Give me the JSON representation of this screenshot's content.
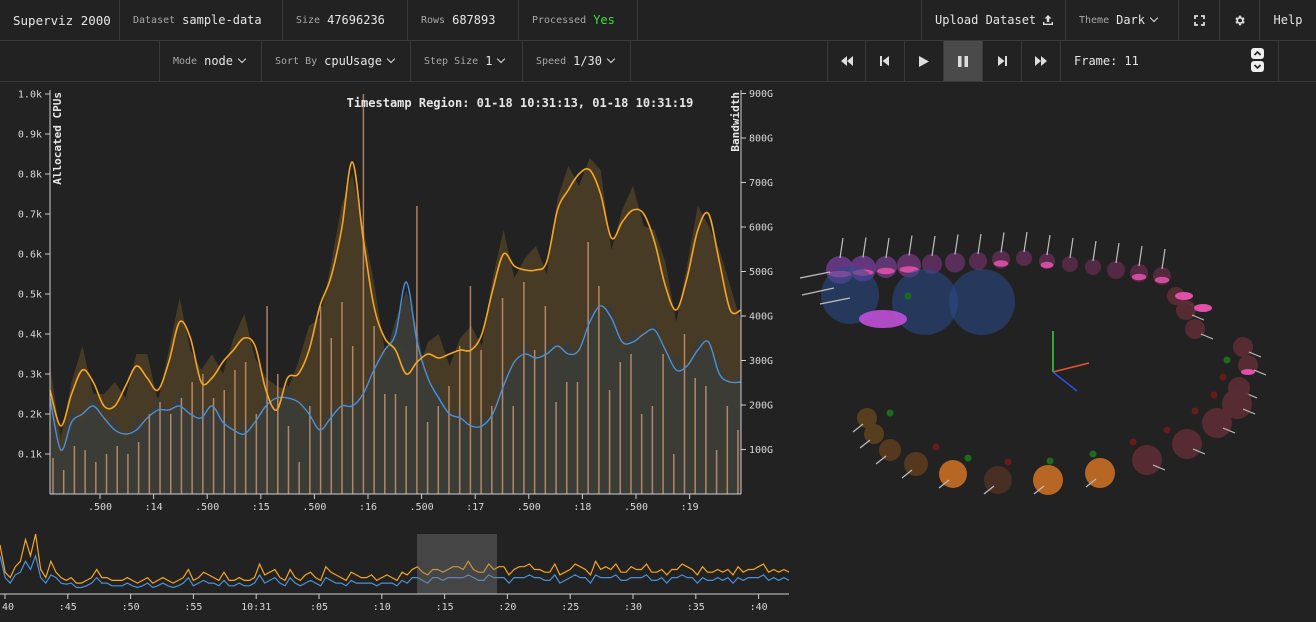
{
  "app": {
    "title": "Superviz 2000",
    "dataset_label": "Dataset",
    "dataset_value": "sample-data",
    "size_label": "Size",
    "size_value": "47696236",
    "rows_label": "Rows",
    "rows_value": "687893",
    "processed_label": "Processed",
    "processed_value": "Yes",
    "upload_label": "Upload Dataset",
    "theme_label": "Theme",
    "theme_value": "Dark",
    "help_label": "Help"
  },
  "controls": {
    "mode_label": "Mode",
    "mode_value": "node",
    "sort_label": "Sort By",
    "sort_value": "cpuUsage",
    "step_label": "Step Size",
    "step_value": "1",
    "speed_label": "Speed",
    "speed_value": "1/30",
    "frame_label": "Frame:",
    "frame_value": "11"
  },
  "icons": [
    "upload-icon",
    "fullscreen-icon",
    "gear-icon",
    "rewind-icon",
    "step-back-icon",
    "play-icon",
    "pause-icon",
    "step-forward-icon",
    "fast-forward-icon",
    "spin-up-icon",
    "spin-down-icon"
  ],
  "colors": {
    "background": "#222222",
    "cpu_line": "#f5a623",
    "bandwidth_line": "#4a90d9",
    "cpu_area": "#4a3d27",
    "bandwidth_area": "#3c3c38",
    "bars": "#d8a07a",
    "processed": "#3ddc3d"
  },
  "chart_data": [
    {
      "type": "line",
      "title": "Timestamp Region: 01-18 10:31:13, 01-18 10:31:19",
      "ylabel": "Allocated CPUs",
      "y2label": "Bandwidth",
      "ylim": [
        0,
        1000
      ],
      "y2lim": [
        0,
        1000
      ],
      "x_ticks": [
        ".500",
        ":14",
        ".500",
        ":15",
        ".500",
        ":16",
        ".500",
        ":17",
        ".500",
        ":18",
        ".500",
        ":19"
      ],
      "y_ticks": [
        "0.1k",
        "0.2k",
        "0.3k",
        "0.4k",
        "0.5k",
        "0.6k",
        "0.7k",
        "0.8k",
        "0.9k",
        "1.0k"
      ],
      "y2_ticks": [
        "100G",
        "200G",
        "300G",
        "400G",
        "500G",
        "600G",
        "700G",
        "800G",
        "900G"
      ],
      "series": [
        {
          "values": [
            260,
            170,
            250,
            310,
            280,
            220,
            220,
            270,
            320,
            290,
            260,
            330,
            430,
            390,
            280,
            290,
            330,
            360,
            390,
            370,
            260,
            210,
            290,
            300,
            360,
            470,
            540,
            660,
            830,
            640,
            470,
            390,
            360,
            300,
            330,
            350,
            340,
            350,
            360,
            360,
            400,
            510,
            600,
            570,
            560,
            560,
            580,
            710,
            760,
            800,
            810,
            750,
            640,
            680,
            710,
            700,
            630,
            520,
            460,
            540,
            660,
            700,
            580,
            460,
            460
          ]
        },
        {
          "values": [
            240,
            110,
            180,
            200,
            220,
            190,
            160,
            150,
            160,
            190,
            210,
            210,
            220,
            200,
            190,
            220,
            180,
            160,
            150,
            180,
            220,
            240,
            240,
            230,
            200,
            160,
            190,
            220,
            220,
            250,
            310,
            360,
            400,
            530,
            380,
            290,
            240,
            200,
            190,
            170,
            170,
            200,
            270,
            330,
            350,
            340,
            350,
            370,
            350,
            360,
            430,
            470,
            440,
            380,
            380,
            400,
            410,
            360,
            310,
            320,
            360,
            380,
            300,
            280,
            280
          ]
        }
      ],
      "bars": [
        90,
        60,
        120,
        110,
        80,
        100,
        120,
        100,
        130,
        200,
        230,
        200,
        240,
        280,
        300,
        240,
        260,
        310,
        330,
        200,
        470,
        300,
        170,
        80,
        220,
        470,
        390,
        480,
        370,
        1000,
        420,
        250,
        250,
        220,
        720,
        180,
        220,
        270,
        370,
        520,
        360,
        220,
        490,
        220,
        530,
        360,
        470,
        230,
        280,
        280,
        630,
        520,
        260,
        330,
        350,
        200,
        220,
        350,
        100,
        400,
        290,
        270,
        110,
        220,
        160
      ]
    },
    {
      "type": "line",
      "x_ticks": [
        ":40",
        ":45",
        ":50",
        ":55",
        "10:31",
        ":05",
        ":10",
        ":15",
        ":20",
        ":25",
        ":30",
        ":35",
        ":40"
      ],
      "brush_range": [
        ":13",
        ":19"
      ],
      "series": [
        {
          "values": [
            90,
            40,
            30,
            50,
            60,
            100,
            70,
            110,
            45,
            30,
            60,
            40,
            30,
            25,
            30,
            20,
            20,
            25,
            30,
            45,
            30,
            30,
            25,
            25,
            25,
            30,
            25,
            20,
            25,
            30,
            20,
            25,
            30,
            25,
            20,
            25,
            30,
            45,
            25,
            30,
            40,
            35,
            30,
            25,
            40,
            25,
            25,
            30,
            25,
            25,
            30,
            55,
            35,
            40,
            45,
            30,
            25,
            45,
            30,
            25,
            35,
            40,
            30,
            25,
            50,
            40,
            35,
            30,
            25,
            40,
            35,
            30,
            30,
            35,
            25,
            30,
            35,
            30,
            25,
            40,
            35,
            45,
            50,
            40,
            35,
            45,
            45,
            40,
            45,
            50,
            50,
            45,
            60,
            45,
            40,
            40,
            55,
            45,
            50,
            50,
            35,
            45,
            50,
            50,
            55,
            45,
            45,
            40,
            40,
            55,
            35,
            40,
            45,
            55,
            50,
            45,
            35,
            60,
            45,
            50,
            45,
            55,
            40,
            40,
            50,
            45,
            45,
            55,
            40,
            40,
            45,
            35,
            45,
            45,
            55,
            50,
            45,
            35,
            50,
            40,
            40,
            45,
            40,
            45,
            35,
            50,
            40,
            45,
            45,
            50,
            55,
            40,
            45,
            40,
            45,
            40
          ]
        },
        {
          "values": [
            70,
            30,
            20,
            35,
            40,
            60,
            45,
            70,
            30,
            20,
            35,
            30,
            20,
            18,
            20,
            12,
            12,
            15,
            20,
            30,
            20,
            20,
            15,
            15,
            15,
            20,
            15,
            12,
            15,
            20,
            12,
            15,
            20,
            15,
            12,
            15,
            20,
            30,
            15,
            20,
            25,
            20,
            20,
            15,
            25,
            15,
            15,
            20,
            15,
            15,
            20,
            35,
            20,
            25,
            30,
            20,
            15,
            30,
            20,
            15,
            20,
            25,
            20,
            15,
            30,
            25,
            20,
            20,
            15,
            25,
            20,
            20,
            20,
            20,
            15,
            20,
            20,
            20,
            15,
            25,
            20,
            30,
            30,
            25,
            20,
            30,
            30,
            25,
            30,
            30,
            30,
            30,
            35,
            30,
            25,
            25,
            35,
            30,
            30,
            30,
            20,
            30,
            30,
            30,
            35,
            30,
            30,
            25,
            25,
            35,
            20,
            25,
            30,
            35,
            30,
            30,
            20,
            35,
            30,
            30,
            30,
            35,
            25,
            25,
            30,
            30,
            30,
            35,
            25,
            25,
            30,
            20,
            30,
            30,
            35,
            30,
            30,
            20,
            30,
            25,
            25,
            30,
            25,
            30,
            20,
            30,
            25,
            30,
            30,
            30,
            35,
            25,
            30,
            25,
            30,
            25
          ]
        }
      ]
    }
  ],
  "scene": {
    "nodes_top": [
      {
        "c": "#6a3a8a",
        "r": 14,
        "cyl": true
      },
      {
        "c": "#6a3a8a",
        "r": 13,
        "cyl": true
      },
      {
        "c": "#653a7a",
        "r": 11,
        "cyl": true
      },
      {
        "c": "#6a3470",
        "r": 12,
        "cyl": true
      },
      {
        "c": "#603060",
        "r": 10,
        "cyl": false
      },
      {
        "c": "#603060",
        "r": 10,
        "cyl": false
      },
      {
        "c": "#5e2e55",
        "r": 9,
        "cyl": false
      },
      {
        "c": "#5c2c50",
        "r": 9,
        "cyl": true
      },
      {
        "c": "#5c2c50",
        "r": 8,
        "cyl": false
      },
      {
        "c": "#5c2c50",
        "r": 8,
        "cyl": true
      },
      {
        "c": "#5a2a48",
        "r": 8,
        "cyl": false
      },
      {
        "c": "#5a2a48",
        "r": 8,
        "cyl": false
      },
      {
        "c": "#5a2a48",
        "r": 9,
        "cyl": false
      },
      {
        "c": "#5a2a48",
        "r": 9,
        "cyl": true
      },
      {
        "c": "#5a2a40",
        "r": 9,
        "cyl": true
      }
    ]
  }
}
